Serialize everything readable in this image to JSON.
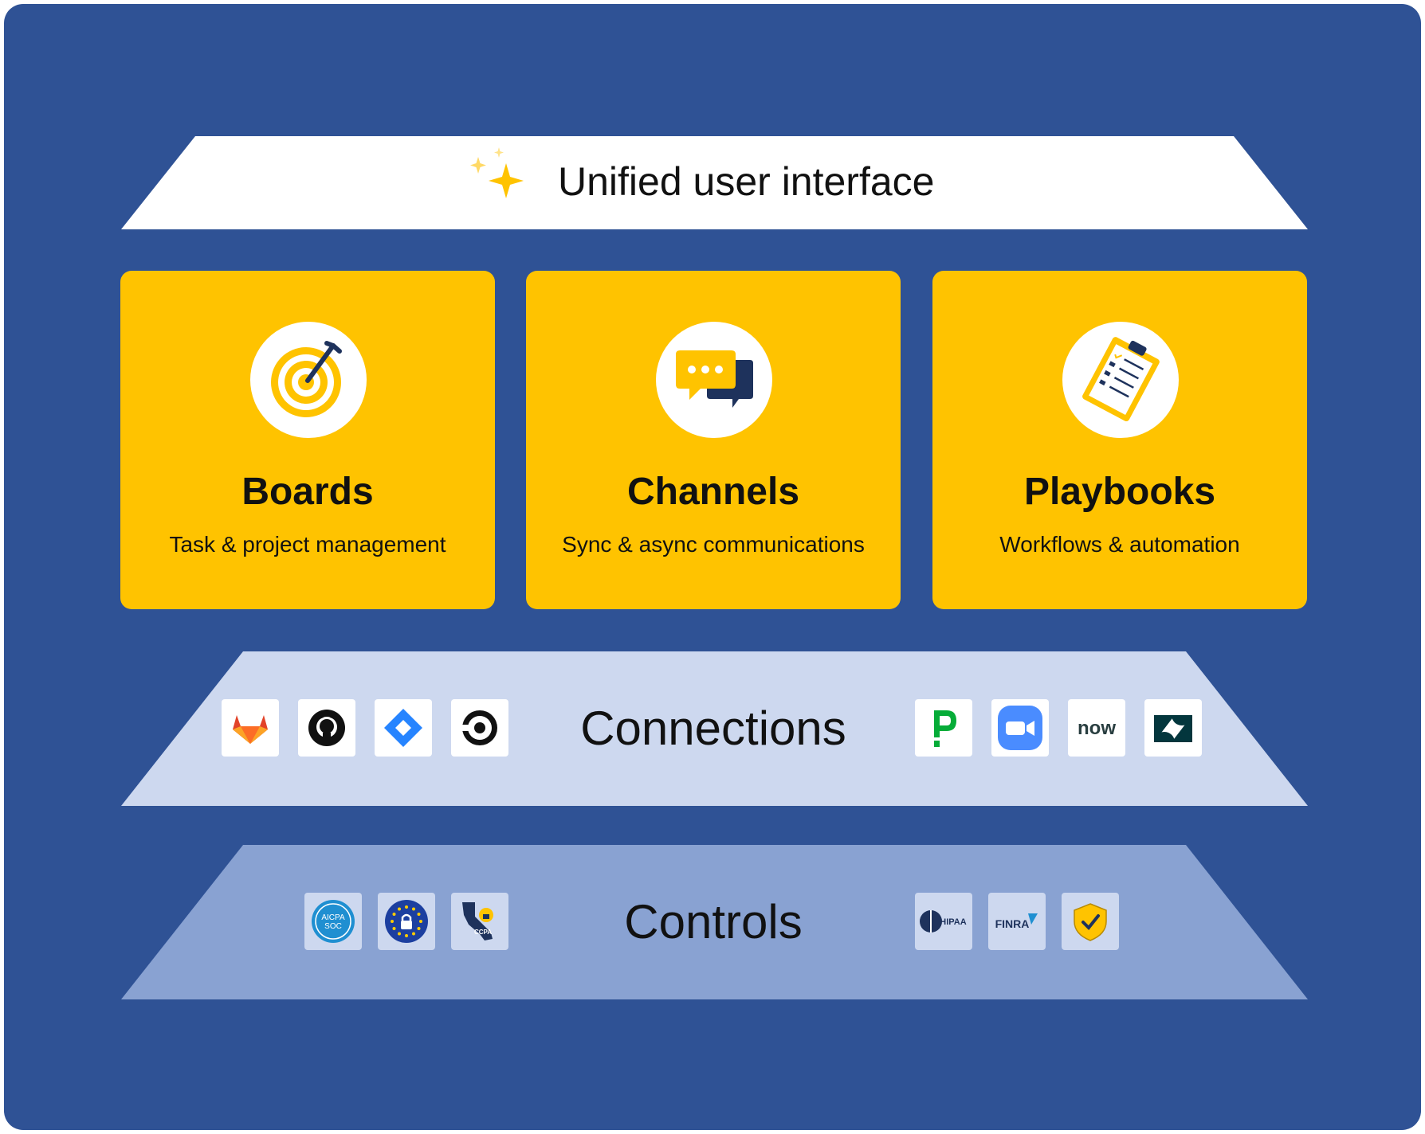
{
  "banner": {
    "title": "Unified user interface"
  },
  "cards": [
    {
      "title": "Boards",
      "subtitle": "Task & project management",
      "icon": "target-icon"
    },
    {
      "title": "Channels",
      "subtitle": "Sync & async communications",
      "icon": "chat-bubbles-icon"
    },
    {
      "title": "Playbooks",
      "subtitle": "Workflows & automation",
      "icon": "clipboard-checklist-icon"
    }
  ],
  "connections": {
    "label": "Connections",
    "left_logos": [
      "gitlab-logo",
      "github-logo",
      "jira-logo",
      "circleci-logo"
    ],
    "right_logos": [
      "pagerduty-logo",
      "zoom-logo",
      "servicenow-logo",
      "zendesk-logo"
    ],
    "now_text": "now"
  },
  "controls": {
    "label": "Controls",
    "left_logos": [
      "aicpa-soc-logo",
      "gdpr-eu-logo",
      "ccpa-logo"
    ],
    "right_logos": [
      "hipaa-logo",
      "finra-logo",
      "security-shield-logo"
    ],
    "aicpa_text": "AICPA",
    "soc_text": "SOC",
    "ccpa_text": "CCPA",
    "hipaa_text": "HIPAA",
    "finra_text": "FINRA"
  },
  "colors": {
    "background": "#2f5295",
    "card": "#ffc300",
    "connections_band": "#cdd8ef",
    "controls_band": "#89a2d2",
    "banner": "#ffffff"
  }
}
